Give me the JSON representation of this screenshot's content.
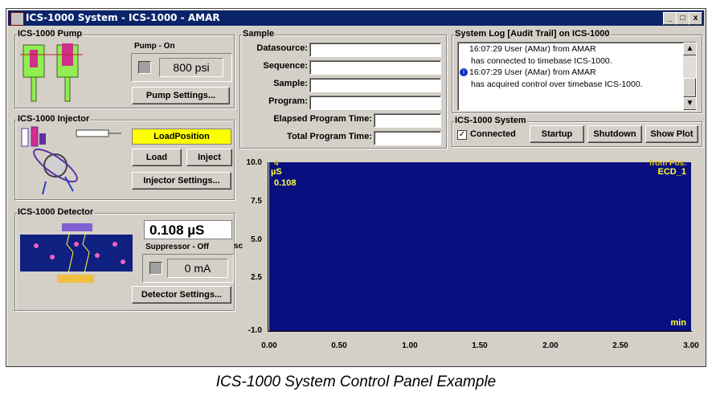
{
  "window": {
    "title": "ICS-1000 System - ICS-1000 - AMAR",
    "minimize": "_",
    "maximize": "□",
    "close": "x"
  },
  "pump": {
    "group_title": "ICS-1000 Pump",
    "status_label": "Pump - On",
    "pressure": "800 psi",
    "settings_button": "Pump Settings..."
  },
  "injector": {
    "group_title": "ICS-1000 Injector",
    "position": "LoadPosition",
    "load_button": "Load",
    "inject_button": "Inject",
    "settings_button": "Injector Settings..."
  },
  "detector": {
    "group_title": "ICS-1000 Detector",
    "conductivity": "0.108 µS",
    "suppressor_label": "Suppressor - Off",
    "suppressor_current": "0 mA",
    "settings_button": "Detector Settings..."
  },
  "sample": {
    "group_title": "Sample",
    "datasource_label": "Datasource:",
    "sequence_label": "Sequence:",
    "sample_label": "Sample:",
    "program_label": "Program:",
    "elapsed_label": "Elapsed Program Time:",
    "total_label": "Total Program Time:"
  },
  "log": {
    "group_title": "System Log [Audit Trail] on ICS-1000",
    "lines": [
      "16:07:29 User  (AMar) from AMAR",
      "has connected to timebase ICS-1000.",
      "16:07:29 User  (AMar) from AMAR",
      "has acquired control over timebase ICS-1000."
    ]
  },
  "system": {
    "group_title": "ICS-1000 System",
    "connected_label": "Connected",
    "connected_checked": true,
    "startup_button": "Startup",
    "shutdown_button": "Shutdown",
    "showplot_button": "Show Plot"
  },
  "plot": {
    "unit": "µS",
    "current_value": "0.108",
    "channel": "ECD_1",
    "x_unit": "min",
    "header_left": "4",
    "header_right": "from Pos.",
    "y_ticks": [
      "10.0",
      "7.5",
      "5.0",
      "2.5",
      "-1.0"
    ],
    "x_ticks": [
      "0.00",
      "0.50",
      "1.00",
      "1.50",
      "2.00",
      "2.50",
      "3.00"
    ],
    "cut_label": "sc"
  },
  "caption": "ICS-1000 System Control Panel Example"
}
